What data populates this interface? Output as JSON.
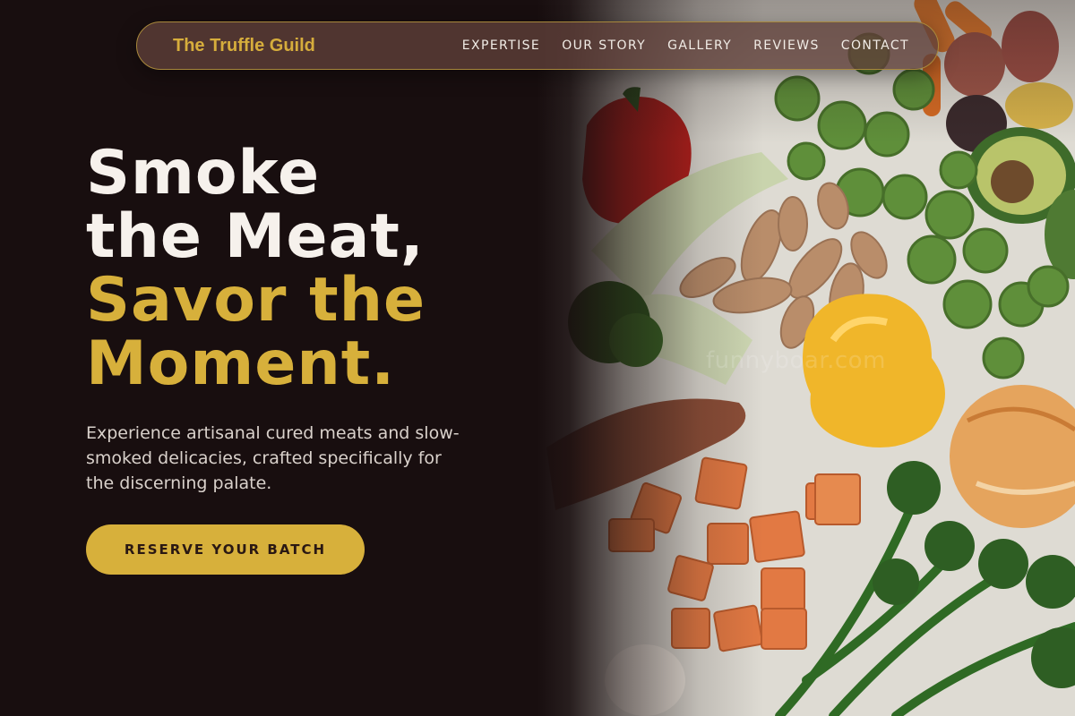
{
  "brand": {
    "name": "The Truffle Guild"
  },
  "nav": {
    "links": [
      {
        "label": "EXPERTISE"
      },
      {
        "label": "OUR STORY"
      },
      {
        "label": "GALLERY"
      },
      {
        "label": "REVIEWS"
      },
      {
        "label": "CONTACT"
      }
    ]
  },
  "hero": {
    "title_line1": "Smoke",
    "title_line2": "the Meat,",
    "title_line3": "Savor the",
    "title_line4": "Moment.",
    "subtitle": "Experience artisanal cured meats and slow-smoked delicacies, crafted specifically for the discerning palate.",
    "cta_label": "RESERVE YOUR BATCH"
  },
  "image": {
    "watermark": "funnyboar.com",
    "alt": "vegetables-photo"
  },
  "colors": {
    "background": "#180e0f",
    "accent_gold": "#d7b03b",
    "nav_pill": "#60403a",
    "text_light": "#f6f1ec"
  }
}
